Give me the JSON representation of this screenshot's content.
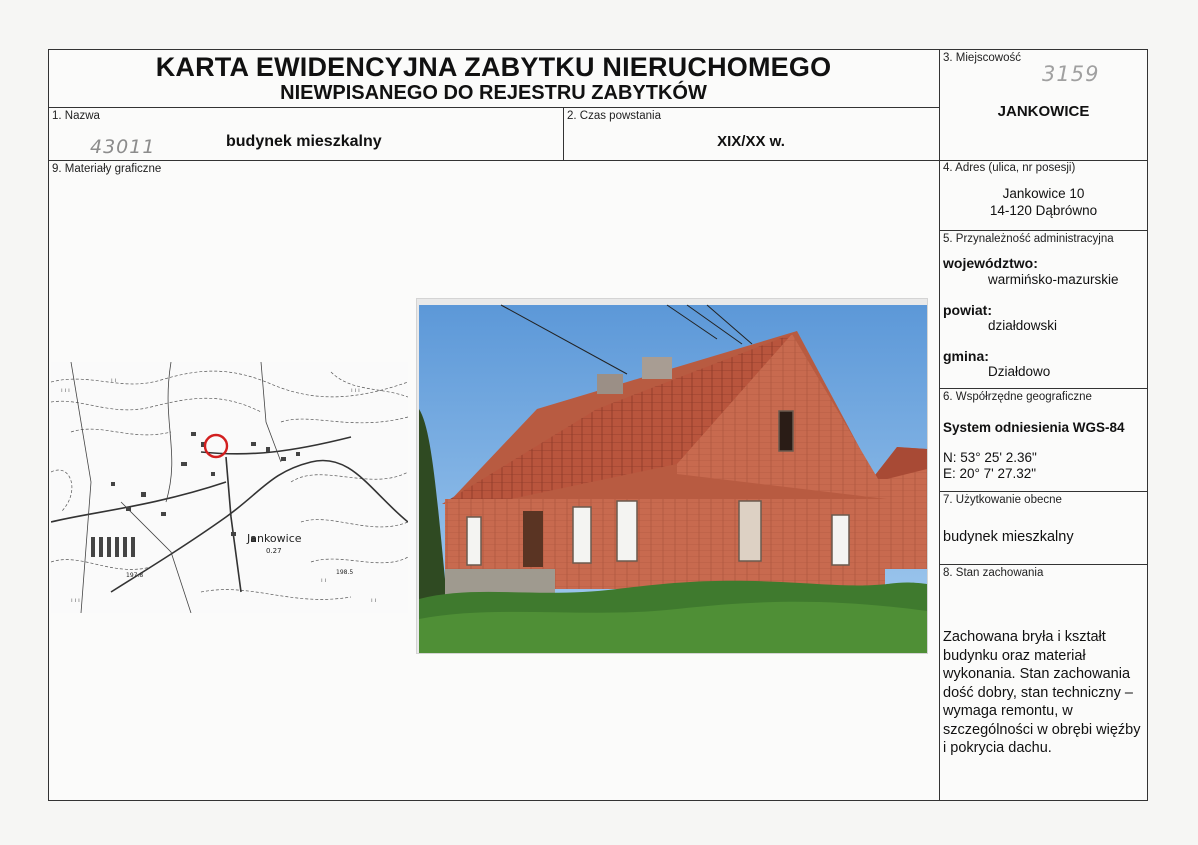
{
  "header": {
    "title_line1": "KARTA EWIDENCYJNA ZABYTKU NIERUCHOMEGO",
    "title_line2": "NIEWPISANEGO DO REJESTRU ZABYTKÓW"
  },
  "handwritten": {
    "card_number": "3159",
    "inventory_number": "43011"
  },
  "fields": {
    "name": {
      "label": "1. Nazwa",
      "value": "budynek mieszkalny"
    },
    "date": {
      "label": "2. Czas powstania",
      "value": "XIX/XX w."
    },
    "locality": {
      "label": "3. Miejscowość",
      "value": "JANKOWICE"
    },
    "address": {
      "label": "4. Adres (ulica, nr posesji)",
      "line1": "Jankowice 10",
      "line2": "14-120 Dąbrówno"
    },
    "admin": {
      "label": "5. Przynależność administracyjna",
      "voivodeship_label": "województwo:",
      "voivodeship": "warmińsko-mazurskie",
      "county_label": "powiat:",
      "county": "działdowski",
      "commune_label": "gmina:",
      "commune": "Działdowo"
    },
    "coords": {
      "label": "6. Współrzędne geograficzne",
      "system": "System odniesienia WGS-84",
      "north": "N: 53° 25' 2.36\"",
      "east": "E: 20° 7' 27.32\""
    },
    "usage": {
      "label": "7. Użytkowanie obecne",
      "value": "budynek mieszkalny"
    },
    "state": {
      "label": "8. Stan zachowania",
      "value": "Zachowana bryła i kształt budynku oraz materiał wykonania. Stan zachowania dość dobry, stan techniczny – wymaga remontu, w szczególności w obrębi więźby i pokrycia dachu."
    },
    "graphics": {
      "label": "9. Materiały graficzne"
    }
  },
  "map": {
    "place_label": "Jankowice",
    "spot_height_1": "0.27",
    "spot_height_2": "198.5",
    "spot_height_3": "197.8",
    "marker_color": "#d21f1f"
  }
}
